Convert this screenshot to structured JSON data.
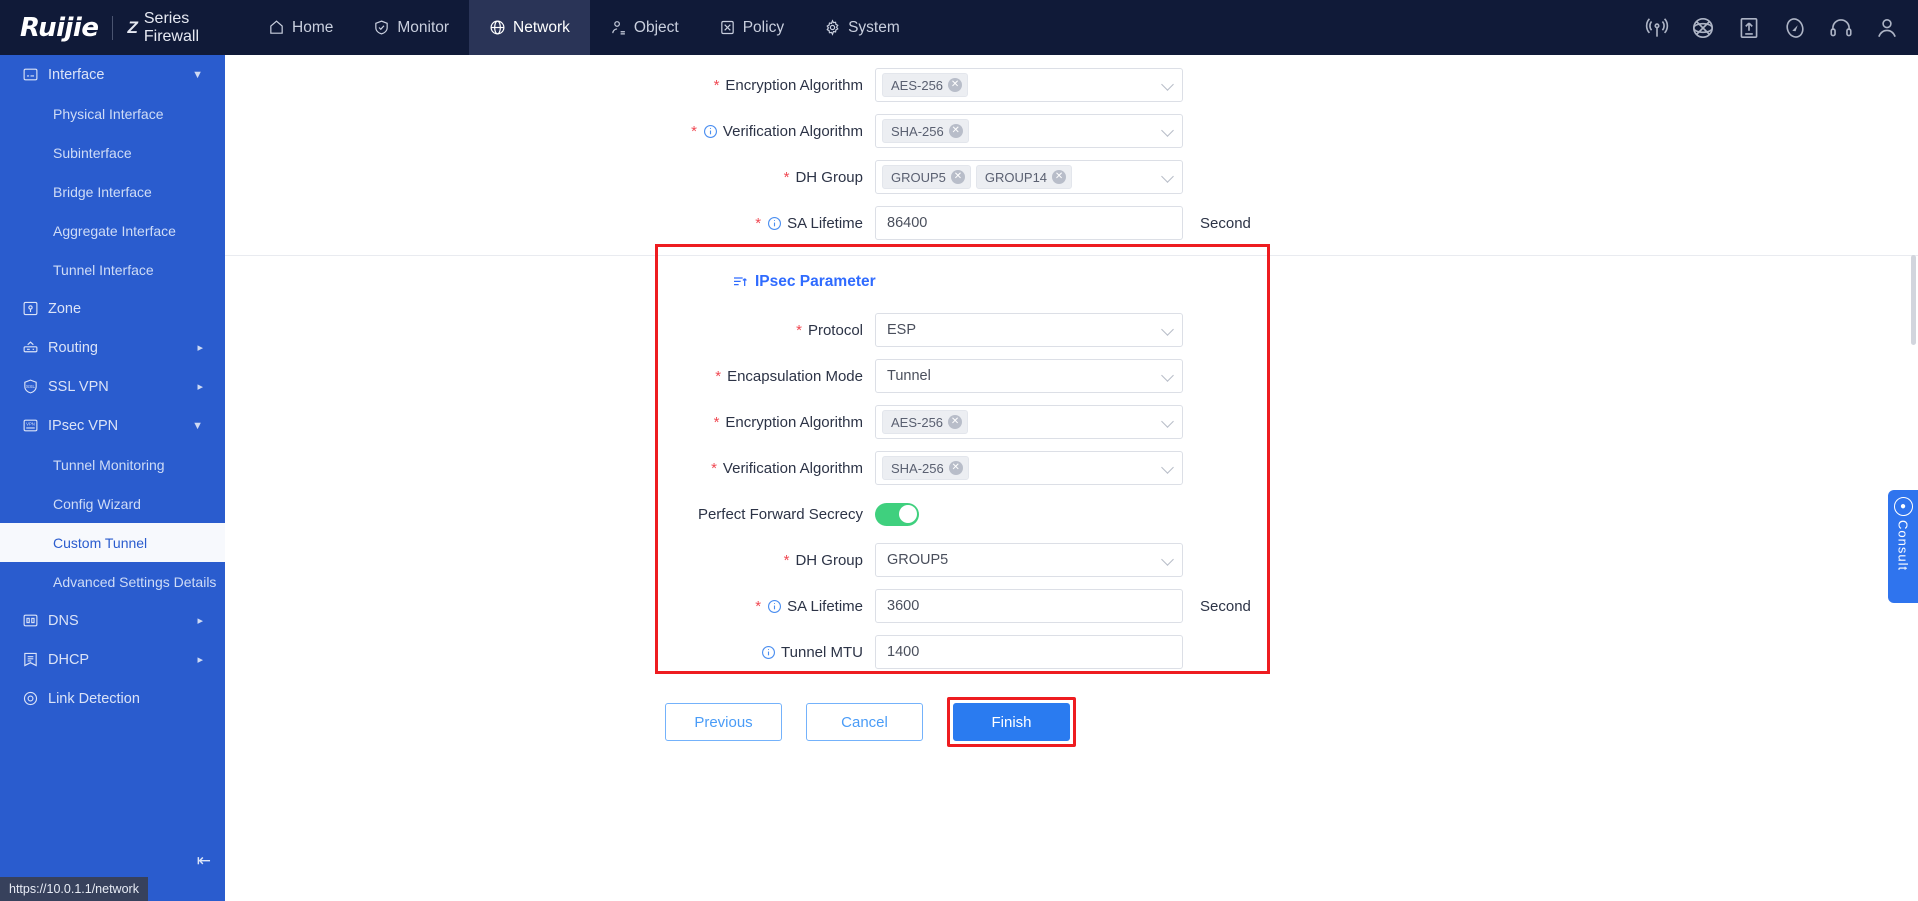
{
  "header": {
    "logo": "Ruijie",
    "product": "Series Firewall",
    "product_mark": "Z",
    "nav": [
      {
        "label": "Home",
        "icon": "home-icon",
        "active": false
      },
      {
        "label": "Monitor",
        "icon": "shield-check-icon",
        "active": false
      },
      {
        "label": "Network",
        "icon": "globe-icon",
        "active": true
      },
      {
        "label": "Object",
        "icon": "user-object-icon",
        "active": false
      },
      {
        "label": "Policy",
        "icon": "policy-icon",
        "active": false
      },
      {
        "label": "System",
        "icon": "gear-icon",
        "active": false
      }
    ],
    "right_icons": [
      "signal-broadcast-icon",
      "globe-grid-icon",
      "upload-icon",
      "compass-icon",
      "headset-icon",
      "user-avatar-icon"
    ]
  },
  "sidebar": {
    "items": [
      {
        "label": "Interface",
        "type": "group",
        "icon": "interface-icon",
        "expanded": true,
        "caret": "chevron-down-icon"
      },
      {
        "label": "Physical Interface",
        "type": "sub",
        "selected": false
      },
      {
        "label": "Subinterface",
        "type": "sub",
        "selected": false
      },
      {
        "label": "Bridge Interface",
        "type": "sub",
        "selected": false
      },
      {
        "label": "Aggregate Interface",
        "type": "sub",
        "selected": false
      },
      {
        "label": "Tunnel Interface",
        "type": "sub",
        "selected": false
      },
      {
        "label": "Zone",
        "type": "group",
        "icon": "zone-icon",
        "expanded": false,
        "caret": ""
      },
      {
        "label": "Routing",
        "type": "group",
        "icon": "routing-icon",
        "expanded": false,
        "caret": "chevron-right-icon"
      },
      {
        "label": "SSL VPN",
        "type": "group",
        "icon": "ssl-vpn-icon",
        "expanded": false,
        "caret": "chevron-right-icon"
      },
      {
        "label": "IPsec VPN",
        "type": "group",
        "icon": "ipsec-vpn-icon",
        "expanded": true,
        "caret": "chevron-down-icon"
      },
      {
        "label": "Tunnel Monitoring",
        "type": "sub",
        "selected": false
      },
      {
        "label": "Config Wizard",
        "type": "sub",
        "selected": false
      },
      {
        "label": "Custom Tunnel",
        "type": "sub",
        "selected": true
      },
      {
        "label": "Advanced Settings Details",
        "type": "sub",
        "selected": false
      },
      {
        "label": "DNS",
        "type": "group",
        "icon": "dns-icon",
        "expanded": false,
        "caret": "chevron-right-icon"
      },
      {
        "label": "DHCP",
        "type": "group",
        "icon": "dhcp-icon",
        "expanded": false,
        "caret": "chevron-right-icon"
      },
      {
        "label": "Link Detection",
        "type": "group",
        "icon": "link-detection-icon",
        "expanded": false,
        "caret": ""
      }
    ],
    "collapse_icon": "collapse-sidebar-icon"
  },
  "status_bar": {
    "url": "https://10.0.1.1/network"
  },
  "ike_section": {
    "rows": [
      {
        "label": "Encryption Algorithm",
        "required": true,
        "info": false,
        "control": "tags",
        "tags": [
          "AES-256"
        ],
        "unit": ""
      },
      {
        "label": "Verification Algorithm",
        "required": true,
        "info": true,
        "control": "tags",
        "tags": [
          "SHA-256"
        ],
        "unit": ""
      },
      {
        "label": "DH Group",
        "required": true,
        "info": false,
        "control": "tags",
        "tags": [
          "GROUP5",
          "GROUP14"
        ],
        "unit": ""
      },
      {
        "label": "SA Lifetime",
        "required": true,
        "info": true,
        "control": "input",
        "value": "86400",
        "unit": "Second"
      }
    ]
  },
  "ipsec_section": {
    "title": "IPsec Parameter",
    "title_icon": "list-sort-icon",
    "rows": [
      {
        "label": "Protocol",
        "required": true,
        "info": false,
        "control": "select",
        "value": "ESP",
        "unit": ""
      },
      {
        "label": "Encapsulation Mode",
        "required": true,
        "info": false,
        "control": "select",
        "value": "Tunnel",
        "unit": ""
      },
      {
        "label": "Encryption Algorithm",
        "required": true,
        "info": false,
        "control": "tags",
        "tags": [
          "AES-256"
        ],
        "unit": ""
      },
      {
        "label": "Verification Algorithm",
        "required": true,
        "info": false,
        "control": "tags",
        "tags": [
          "SHA-256"
        ],
        "unit": ""
      },
      {
        "label": "Perfect Forward Secrecy",
        "required": false,
        "info": false,
        "control": "toggle",
        "value": "on",
        "unit": ""
      },
      {
        "label": "DH Group",
        "required": true,
        "info": false,
        "control": "select",
        "value": "GROUP5",
        "unit": ""
      },
      {
        "label": "SA Lifetime",
        "required": true,
        "info": true,
        "control": "input",
        "value": "3600",
        "unit": "Second"
      },
      {
        "label": "Tunnel MTU",
        "required": false,
        "info": true,
        "control": "input",
        "value": "1400",
        "unit": ""
      }
    ]
  },
  "footer": {
    "previous": "Previous",
    "cancel": "Cancel",
    "finish": "Finish"
  },
  "consult": {
    "label": "Consult",
    "icon": "chat-bubble-icon"
  },
  "colors": {
    "nav_bg": "#101a38",
    "sidebar_bg": "#2a5cce",
    "accent_blue": "#2f6bff",
    "primary_button": "#2a7bf0",
    "required_red": "#f04953",
    "highlight_red": "#ee1c20",
    "toggle_on_green": "#3fd07e"
  }
}
